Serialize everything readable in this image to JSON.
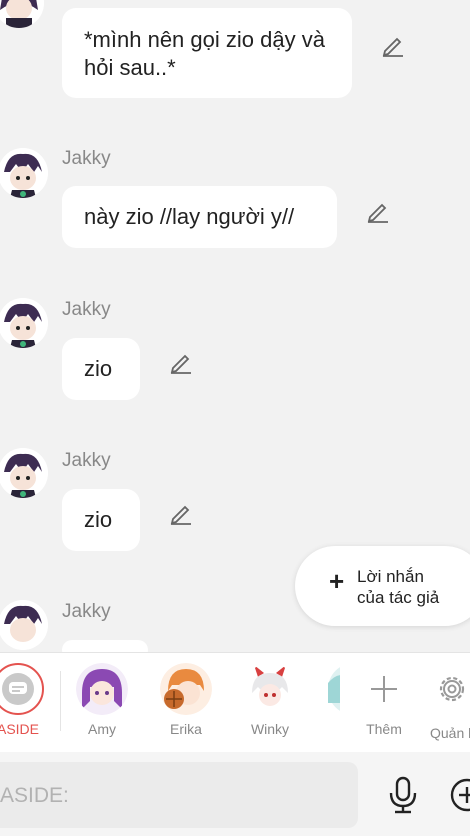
{
  "messages": [
    {
      "sender": "",
      "text": "*mình nên gọi zio dậy và hỏi sau..*"
    },
    {
      "sender": "Jakky",
      "text": "này zio //lay người y//"
    },
    {
      "sender": "Jakky",
      "text": "zio"
    },
    {
      "sender": "Jakky",
      "text": "zio"
    },
    {
      "sender": "Jakky",
      "text": ""
    }
  ],
  "author_note": {
    "plus": "+",
    "line1": "Lời nhắn",
    "line2": "của tác giả"
  },
  "characters": [
    {
      "name": "ASIDE",
      "icon": "chat-bubble-icon",
      "color": "#e4534f"
    },
    {
      "name": "Amy",
      "icon": "purple-hair-avatar"
    },
    {
      "name": "Erika",
      "icon": "orange-hair-avatar"
    },
    {
      "name": "Winky",
      "icon": "white-horned-avatar"
    }
  ],
  "actions": {
    "add_label": "Thêm",
    "manage_label": "Quản l"
  },
  "input": {
    "placeholder": "ASIDE:"
  },
  "colors": {
    "accent": "#e4534f",
    "bubble": "#ffffff",
    "background": "#f2f2f2"
  }
}
